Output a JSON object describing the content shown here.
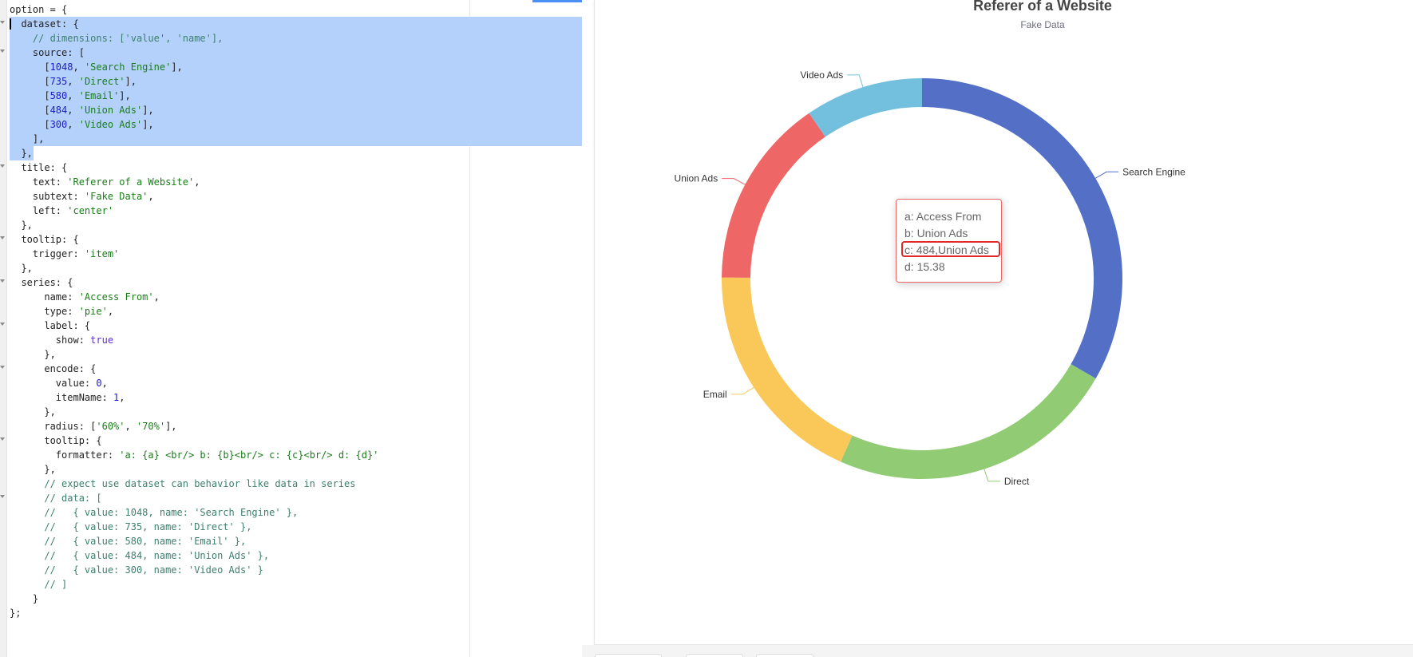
{
  "editor": {
    "lines": [
      {
        "fold": false,
        "sel": false,
        "tokens": [
          {
            "t": "option = {",
            "c": ""
          }
        ]
      },
      {
        "fold": true,
        "sel": true,
        "tokens": [
          {
            "t": "  dataset: {",
            "c": ""
          }
        ]
      },
      {
        "fold": false,
        "sel": true,
        "tokens": [
          {
            "t": "    // dimensions: ['value', 'name'],",
            "c": "com"
          }
        ]
      },
      {
        "fold": true,
        "sel": true,
        "tokens": [
          {
            "t": "    source: [",
            "c": ""
          }
        ]
      },
      {
        "fold": false,
        "sel": true,
        "tokens": [
          {
            "t": "      [",
            "c": ""
          },
          {
            "t": "1048",
            "c": "num"
          },
          {
            "t": ", ",
            "c": ""
          },
          {
            "t": "'Search Engine'",
            "c": "str"
          },
          {
            "t": "],",
            "c": ""
          }
        ]
      },
      {
        "fold": false,
        "sel": true,
        "tokens": [
          {
            "t": "      [",
            "c": ""
          },
          {
            "t": "735",
            "c": "num"
          },
          {
            "t": ", ",
            "c": ""
          },
          {
            "t": "'Direct'",
            "c": "str"
          },
          {
            "t": "],",
            "c": ""
          }
        ]
      },
      {
        "fold": false,
        "sel": true,
        "tokens": [
          {
            "t": "      [",
            "c": ""
          },
          {
            "t": "580",
            "c": "num"
          },
          {
            "t": ", ",
            "c": ""
          },
          {
            "t": "'Email'",
            "c": "str"
          },
          {
            "t": "],",
            "c": ""
          }
        ]
      },
      {
        "fold": false,
        "sel": true,
        "tokens": [
          {
            "t": "      [",
            "c": ""
          },
          {
            "t": "484",
            "c": "num"
          },
          {
            "t": ", ",
            "c": ""
          },
          {
            "t": "'Union Ads'",
            "c": "str"
          },
          {
            "t": "],",
            "c": ""
          }
        ]
      },
      {
        "fold": false,
        "sel": true,
        "tokens": [
          {
            "t": "      [",
            "c": ""
          },
          {
            "t": "300",
            "c": "num"
          },
          {
            "t": ", ",
            "c": ""
          },
          {
            "t": "'Video Ads'",
            "c": "str"
          },
          {
            "t": "],",
            "c": ""
          }
        ]
      },
      {
        "fold": false,
        "sel": true,
        "tokens": [
          {
            "t": "    ],",
            "c": ""
          }
        ]
      },
      {
        "fold": false,
        "sel": "end",
        "tokens": [
          {
            "t": "  },",
            "c": ""
          }
        ]
      },
      {
        "fold": true,
        "sel": false,
        "tokens": [
          {
            "t": "  title: {",
            "c": ""
          }
        ]
      },
      {
        "fold": false,
        "sel": false,
        "tokens": [
          {
            "t": "    text: ",
            "c": ""
          },
          {
            "t": "'Referer of a Website'",
            "c": "str"
          },
          {
            "t": ",",
            "c": ""
          }
        ]
      },
      {
        "fold": false,
        "sel": false,
        "tokens": [
          {
            "t": "    subtext: ",
            "c": ""
          },
          {
            "t": "'Fake Data'",
            "c": "str"
          },
          {
            "t": ",",
            "c": ""
          }
        ]
      },
      {
        "fold": false,
        "sel": false,
        "tokens": [
          {
            "t": "    left: ",
            "c": ""
          },
          {
            "t": "'center'",
            "c": "str"
          }
        ]
      },
      {
        "fold": false,
        "sel": false,
        "tokens": [
          {
            "t": "  },",
            "c": ""
          }
        ]
      },
      {
        "fold": true,
        "sel": false,
        "tokens": [
          {
            "t": "  tooltip: {",
            "c": ""
          }
        ]
      },
      {
        "fold": false,
        "sel": false,
        "tokens": [
          {
            "t": "    trigger: ",
            "c": ""
          },
          {
            "t": "'item'",
            "c": "str"
          }
        ]
      },
      {
        "fold": false,
        "sel": false,
        "tokens": [
          {
            "t": "  },",
            "c": ""
          }
        ]
      },
      {
        "fold": true,
        "sel": false,
        "tokens": [
          {
            "t": "  series: {",
            "c": ""
          }
        ]
      },
      {
        "fold": false,
        "sel": false,
        "tokens": [
          {
            "t": "      name: ",
            "c": ""
          },
          {
            "t": "'Access From'",
            "c": "str"
          },
          {
            "t": ",",
            "c": ""
          }
        ]
      },
      {
        "fold": false,
        "sel": false,
        "tokens": [
          {
            "t": "      type: ",
            "c": ""
          },
          {
            "t": "'pie'",
            "c": "str"
          },
          {
            "t": ",",
            "c": ""
          }
        ]
      },
      {
        "fold": true,
        "sel": false,
        "tokens": [
          {
            "t": "      label: {",
            "c": ""
          }
        ]
      },
      {
        "fold": false,
        "sel": false,
        "tokens": [
          {
            "t": "        show: ",
            "c": ""
          },
          {
            "t": "true",
            "c": "bool"
          }
        ]
      },
      {
        "fold": false,
        "sel": false,
        "tokens": [
          {
            "t": "      },",
            "c": ""
          }
        ]
      },
      {
        "fold": true,
        "sel": false,
        "tokens": [
          {
            "t": "      encode: {",
            "c": ""
          }
        ]
      },
      {
        "fold": false,
        "sel": false,
        "tokens": [
          {
            "t": "        value: ",
            "c": ""
          },
          {
            "t": "0",
            "c": "num"
          },
          {
            "t": ",",
            "c": ""
          }
        ]
      },
      {
        "fold": false,
        "sel": false,
        "tokens": [
          {
            "t": "        itemName: ",
            "c": ""
          },
          {
            "t": "1",
            "c": "num"
          },
          {
            "t": ",",
            "c": ""
          }
        ]
      },
      {
        "fold": false,
        "sel": false,
        "tokens": [
          {
            "t": "      },",
            "c": ""
          }
        ]
      },
      {
        "fold": false,
        "sel": false,
        "tokens": [
          {
            "t": "      radius: [",
            "c": ""
          },
          {
            "t": "'60%'",
            "c": "str"
          },
          {
            "t": ", ",
            "c": ""
          },
          {
            "t": "'70%'",
            "c": "str"
          },
          {
            "t": "],",
            "c": ""
          }
        ]
      },
      {
        "fold": true,
        "sel": false,
        "tokens": [
          {
            "t": "      tooltip: {",
            "c": ""
          }
        ]
      },
      {
        "fold": false,
        "sel": false,
        "tokens": [
          {
            "t": "        formatter: ",
            "c": ""
          },
          {
            "t": "'a: {a} <br/> b: {b}<br/> c: {c}<br/> d: {d}'",
            "c": "str"
          }
        ]
      },
      {
        "fold": false,
        "sel": false,
        "tokens": [
          {
            "t": "      },",
            "c": ""
          }
        ]
      },
      {
        "fold": false,
        "sel": false,
        "tokens": [
          {
            "t": "      // expect use dataset can behavior like data in series",
            "c": "com"
          }
        ]
      },
      {
        "fold": true,
        "sel": false,
        "tokens": [
          {
            "t": "      // data: [",
            "c": "com"
          }
        ]
      },
      {
        "fold": false,
        "sel": false,
        "tokens": [
          {
            "t": "      //   { value: 1048, name: 'Search Engine' },",
            "c": "com"
          }
        ]
      },
      {
        "fold": false,
        "sel": false,
        "tokens": [
          {
            "t": "      //   { value: 735, name: 'Direct' },",
            "c": "com"
          }
        ]
      },
      {
        "fold": false,
        "sel": false,
        "tokens": [
          {
            "t": "      //   { value: 580, name: 'Email' },",
            "c": "com"
          }
        ]
      },
      {
        "fold": false,
        "sel": false,
        "tokens": [
          {
            "t": "      //   { value: 484, name: 'Union Ads' },",
            "c": "com"
          }
        ]
      },
      {
        "fold": false,
        "sel": false,
        "tokens": [
          {
            "t": "      //   { value: 300, name: 'Video Ads' }",
            "c": "com"
          }
        ]
      },
      {
        "fold": false,
        "sel": false,
        "tokens": [
          {
            "t": "      // ]",
            "c": "com"
          }
        ]
      },
      {
        "fold": false,
        "sel": false,
        "tokens": [
          {
            "t": "    }",
            "c": ""
          }
        ]
      },
      {
        "fold": false,
        "sel": false,
        "tokens": [
          {
            "t": "};",
            "c": ""
          }
        ]
      }
    ]
  },
  "chart_data": {
    "type": "pie",
    "title": "Referer of a Website",
    "subtitle": "Fake Data",
    "series_name": "Access From",
    "radius": [
      "60%",
      "70%"
    ],
    "slices": [
      {
        "name": "Search Engine",
        "value": 1048,
        "color": "#5470c6"
      },
      {
        "name": "Direct",
        "value": 735,
        "color": "#91cc75"
      },
      {
        "name": "Email",
        "value": 580,
        "color": "#fac858"
      },
      {
        "name": "Union Ads",
        "value": 484,
        "color": "#ee6666"
      },
      {
        "name": "Video Ads",
        "value": 300,
        "color": "#73c0de"
      }
    ]
  },
  "tooltip": {
    "line_a": "a: Access From",
    "line_b": "b: Union Ads",
    "line_c": "c: 484,Union Ads",
    "line_d": "d: 15.38",
    "border_color": "#ee6666",
    "highlight_color": "#e02a2a"
  }
}
